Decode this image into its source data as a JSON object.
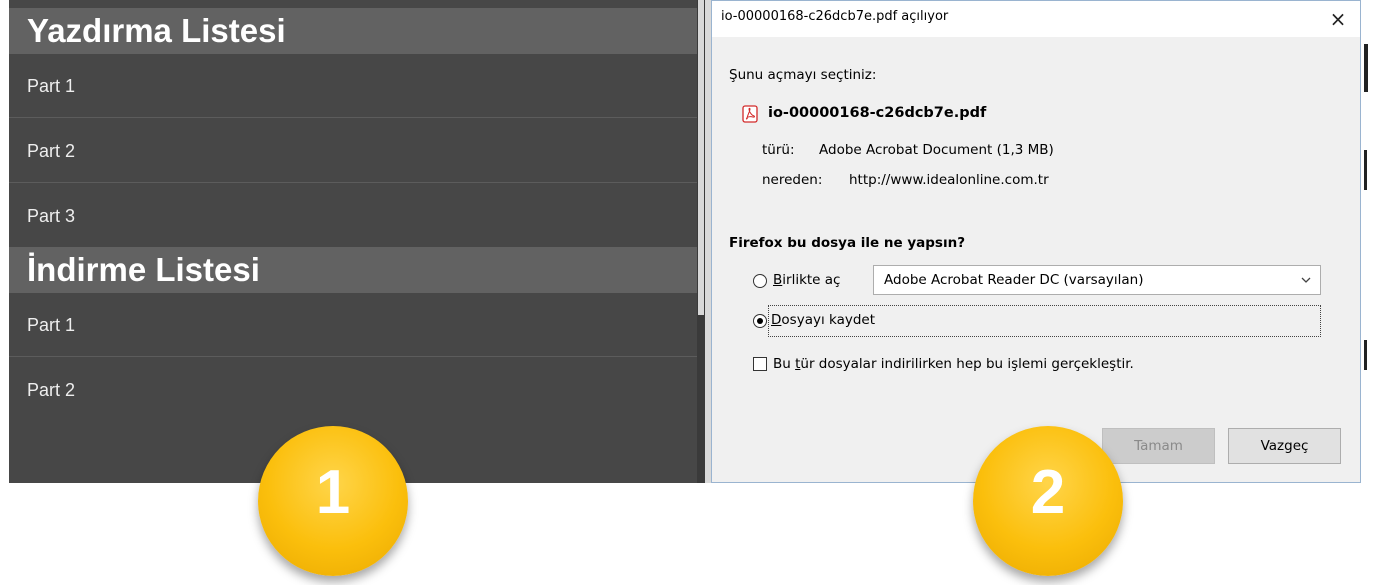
{
  "left_panel": {
    "print_list": {
      "title": "Yazdırma Listesi",
      "items": [
        "Part 1",
        "Part 2",
        "Part 3"
      ]
    },
    "download_list": {
      "title": "İndirme Listesi",
      "items": [
        "Part 1",
        "Part 2"
      ]
    }
  },
  "badges": [
    "1",
    "2"
  ],
  "dialog": {
    "title": "io-00000168-c26dcb7e.pdf açılıyor",
    "close_symbol": "×",
    "intro": "Şunu açmayı seçtiniz:",
    "file_icon": "pdf-icon",
    "file_name": "io-00000168-c26dcb7e.pdf",
    "type_label": "türü:",
    "type_value": "Adobe Acrobat Document (1,3 MB)",
    "from_label": "nereden:",
    "from_value": "http://www.idealonline.com.tr",
    "question": "Firefox bu dosya ile ne yapsın?",
    "open_with": {
      "accel": "B",
      "rest": "irlikte aç",
      "checked": false
    },
    "open_with_app": "Adobe Acrobat Reader DC  (varsayılan)",
    "save_file": {
      "accel": "D",
      "rest": "osyayı kaydet",
      "checked": true
    },
    "always": {
      "pre": "Bu ",
      "accel": "t",
      "rest": "ür dosyalar indirilirken hep bu işlemi gerçekleştir.",
      "checked": false
    },
    "ok_button": "Tamam",
    "cancel_button": "Vazgeç"
  },
  "colors": {
    "panel_bg": "#474747",
    "header_bg": "#626262",
    "badge": "#fbbf0c",
    "dialog_bg": "#f0f0f0",
    "pdf_red": "#d22a2a"
  }
}
